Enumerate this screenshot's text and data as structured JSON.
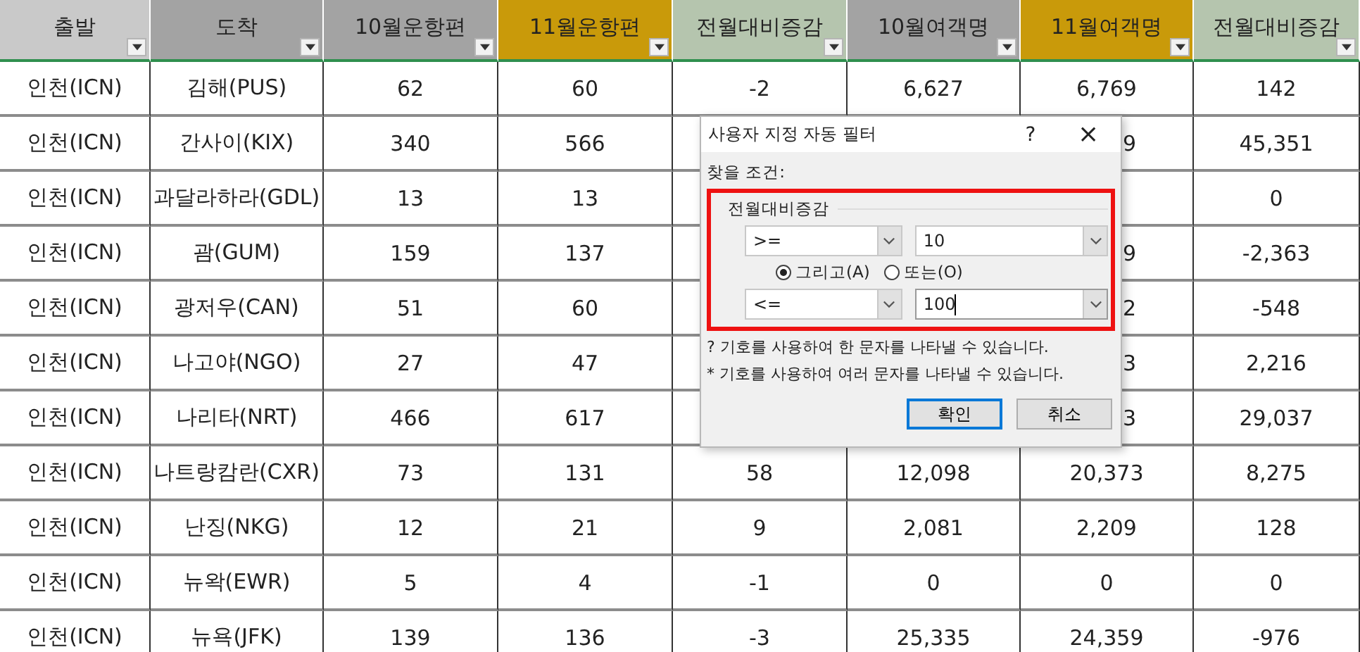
{
  "sheet": {
    "columns": [
      {
        "label": "출발",
        "color": "#c9c9c9"
      },
      {
        "label": "도착",
        "color": "#a3a3a3"
      },
      {
        "label": "10월운항편",
        "color": "#a3a3a3"
      },
      {
        "label": "11월운항편",
        "color": "#c99a0a"
      },
      {
        "label": "전월대비증감",
        "color": "#b5c5ae"
      },
      {
        "label": "10월여객명",
        "color": "#a3a3a3"
      },
      {
        "label": "11월여객명",
        "color": "#c99a0a"
      },
      {
        "label": "전월대비증감",
        "color": "#b5c5ae"
      }
    ],
    "rows": [
      {
        "cells": [
          "인천(ICN)",
          "김해(PUS)",
          "62",
          "60",
          "-2",
          "6,627",
          "6,769",
          "142"
        ]
      },
      {
        "cells": [
          "인천(ICN)",
          "간사이(KIX)",
          "340",
          "566",
          null,
          null,
          {
            "text": "9",
            "kind": "partial"
          },
          "45,351"
        ]
      },
      {
        "cells": [
          "인천(ICN)",
          "과달라하라(GDL)",
          "13",
          "13",
          null,
          null,
          {
            "kind": "blank"
          },
          "0"
        ]
      },
      {
        "cells": [
          "인천(ICN)",
          "괌(GUM)",
          "159",
          "137",
          null,
          null,
          {
            "text": "9",
            "kind": "partial"
          },
          "-2,363"
        ]
      },
      {
        "cells": [
          "인천(ICN)",
          "광저우(CAN)",
          "51",
          "60",
          null,
          null,
          {
            "text": "2",
            "kind": "partial"
          },
          "-548"
        ]
      },
      {
        "cells": [
          "인천(ICN)",
          "나고야(NGO)",
          "27",
          "47",
          null,
          null,
          {
            "text": "3",
            "kind": "partial"
          },
          "2,216"
        ]
      },
      {
        "cells": [
          "인천(ICN)",
          "나리타(NRT)",
          "466",
          "617",
          null,
          null,
          {
            "text": "3",
            "kind": "partial"
          },
          "29,037"
        ]
      },
      {
        "cells": [
          "인천(ICN)",
          "나트랑캄란(CXR)",
          "73",
          "131",
          "58",
          "12,098",
          "20,373",
          "8,275"
        ]
      },
      {
        "cells": [
          "인천(ICN)",
          "난징(NKG)",
          "12",
          "21",
          "9",
          "2,081",
          "2,209",
          "128"
        ]
      },
      {
        "cells": [
          "인천(ICN)",
          "뉴왁(EWR)",
          "5",
          "4",
          "-1",
          "0",
          "0",
          "0"
        ]
      },
      {
        "cells": [
          "인천(ICN)",
          "뉴욕(JFK)",
          "139",
          "136",
          "-3",
          "25,335",
          "24,359",
          "-976"
        ]
      }
    ]
  },
  "dialog": {
    "title": "사용자 지정 자동 필터",
    "help": "?",
    "close": "×",
    "criteria_label": "찾을 조건:",
    "group": {
      "legend": "전월대비증감",
      "highlighted": true,
      "conditions": [
        {
          "operator": ">=",
          "value": "10",
          "focused": false
        },
        {
          "operator": "<=",
          "value": "100",
          "focused": true
        }
      ],
      "radios": [
        {
          "label": "그리고(A)",
          "selected": true
        },
        {
          "label": "또는(O)",
          "selected": false
        }
      ]
    },
    "hints": [
      "? 기호를 사용하여 한 문자를 나타낼 수 있습니다.",
      "* 기호를 사용하여 여러 문자를 나타낼 수 있습니다."
    ],
    "buttons": [
      {
        "label": "확인",
        "default": true
      },
      {
        "label": "취소",
        "default": false
      }
    ]
  }
}
